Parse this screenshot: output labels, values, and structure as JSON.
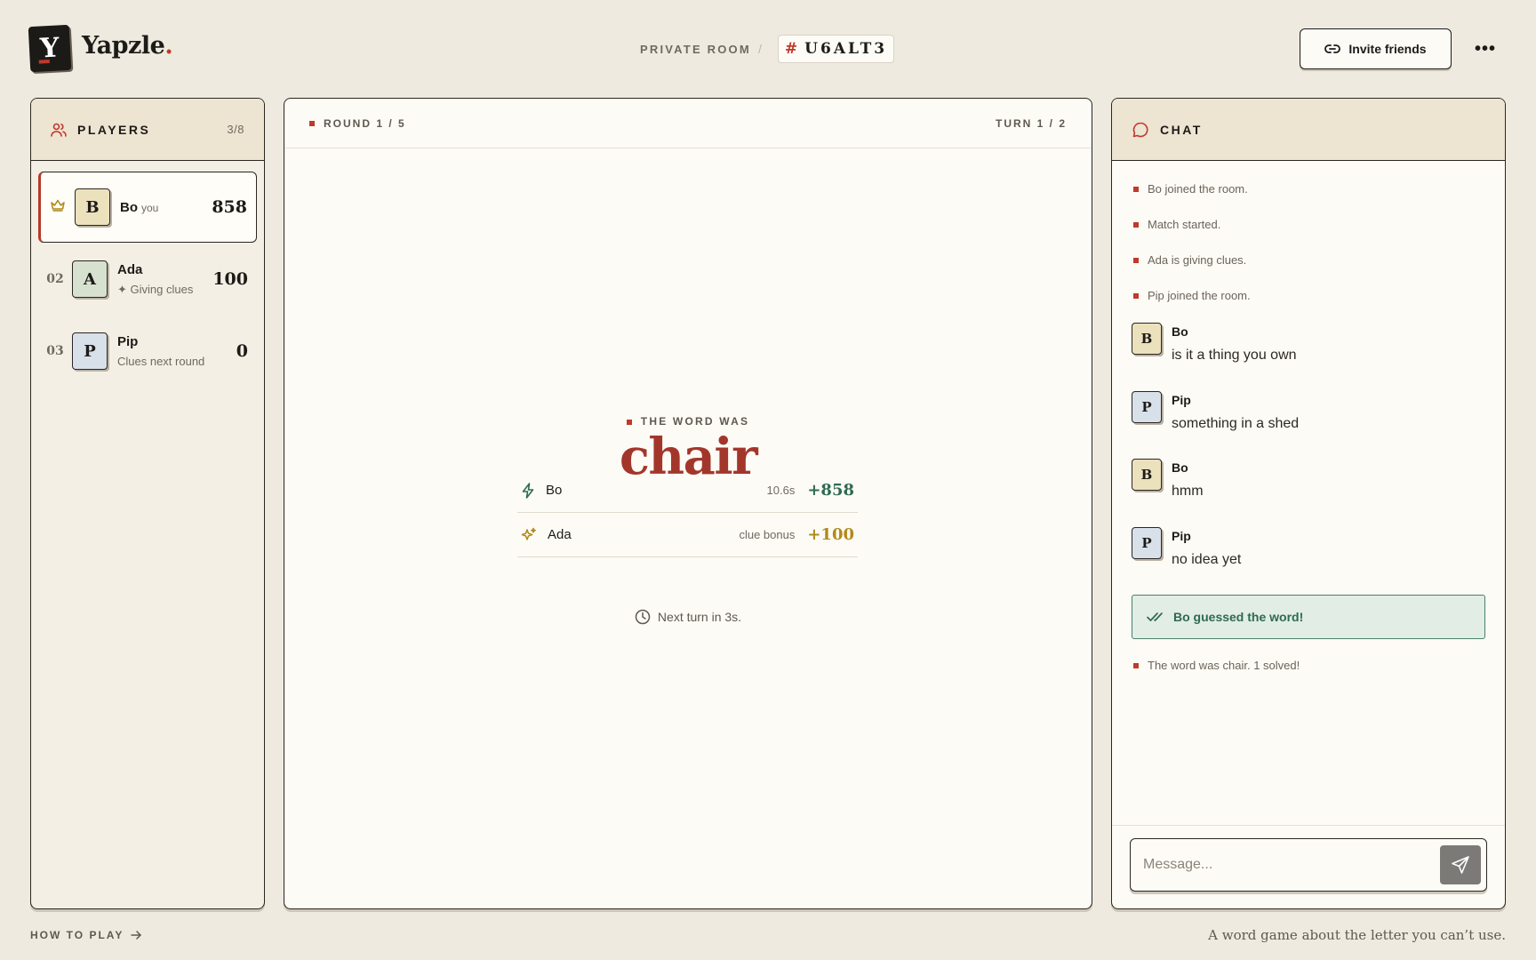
{
  "brand": {
    "logo_letter": "Y",
    "name": "Yapzle",
    "dot": "."
  },
  "room": {
    "label": "PRIVATE ROOM",
    "separator": "/",
    "hash": "#",
    "code": "U6ALT3"
  },
  "header": {
    "invite_label": "Invite friends",
    "more_label": "•••"
  },
  "players": {
    "title": "PLAYERS",
    "count": "3/8",
    "items": [
      {
        "rank": "",
        "letter": "B",
        "name": "Bo",
        "tag": "you",
        "sub": "",
        "score": "858",
        "is_you": true,
        "has_crown": true
      },
      {
        "rank": "02",
        "letter": "A",
        "name": "Ada",
        "tag": "",
        "sub": "✦ Giving clues",
        "score": "100"
      },
      {
        "rank": "03",
        "letter": "P",
        "name": "Pip",
        "tag": "",
        "sub": "Clues next round",
        "score": "0"
      }
    ]
  },
  "game": {
    "round": "ROUND 1 / 5",
    "turn": "TURN 1 / 2",
    "word_label": "THE WORD WAS",
    "word": "chair",
    "results": [
      {
        "icon": "lightning-icon",
        "name": "Bo",
        "meta": "10.6s",
        "points": "+858"
      },
      {
        "icon": "sparkle-icon",
        "name": "Ada",
        "meta": "clue bonus",
        "points": "+100"
      }
    ],
    "next_turn": "Next turn in 3s."
  },
  "chat": {
    "title": "CHAT",
    "system_top": [
      "Bo joined the room.",
      "Match started.",
      "Ada is giving clues.",
      "Pip joined the room."
    ],
    "messages": [
      {
        "letter": "B",
        "name": "Bo",
        "text": "is it a thing you own"
      },
      {
        "letter": "P",
        "name": "Pip",
        "text": "something in a shed"
      },
      {
        "letter": "B",
        "name": "Bo",
        "text": "hmm"
      },
      {
        "letter": "P",
        "name": "Pip",
        "text": "no idea yet"
      }
    ],
    "guess": "Bo guessed the word!",
    "system_bottom": "The word was chair. 1 solved!",
    "input_placeholder": "Message..."
  },
  "footer": {
    "how_to": "HOW TO PLAY",
    "tagline": "A word game about the letter you can’t use."
  },
  "colors": {
    "accent": "#c0392b",
    "word": "#a3362b",
    "success": "#2e6a52",
    "gold": "#b08a1c",
    "background": "#efeadf"
  }
}
